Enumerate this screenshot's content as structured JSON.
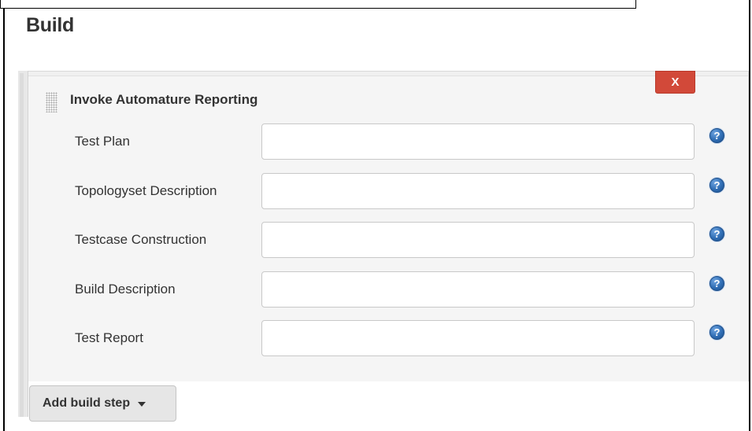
{
  "section": {
    "title": "Build"
  },
  "build_step": {
    "title": "Invoke Automature Reporting",
    "delete_label": "X",
    "delete_color": "#d24939",
    "fields": [
      {
        "label": "Test Plan",
        "value": "",
        "help_icon": "question-circle-icon"
      },
      {
        "label": "Topologyset Description",
        "value": "",
        "help_icon": "question-circle-icon"
      },
      {
        "label": "Testcase Construction",
        "value": "",
        "help_icon": "question-circle-icon"
      },
      {
        "label": "Build Description",
        "value": "",
        "help_icon": "question-circle-icon"
      },
      {
        "label": "Test Report",
        "value": "",
        "help_icon": "question-circle-icon"
      }
    ]
  },
  "help_glyph": "?",
  "add_step": {
    "label": "Add build step",
    "icon": "caret-down-icon"
  }
}
